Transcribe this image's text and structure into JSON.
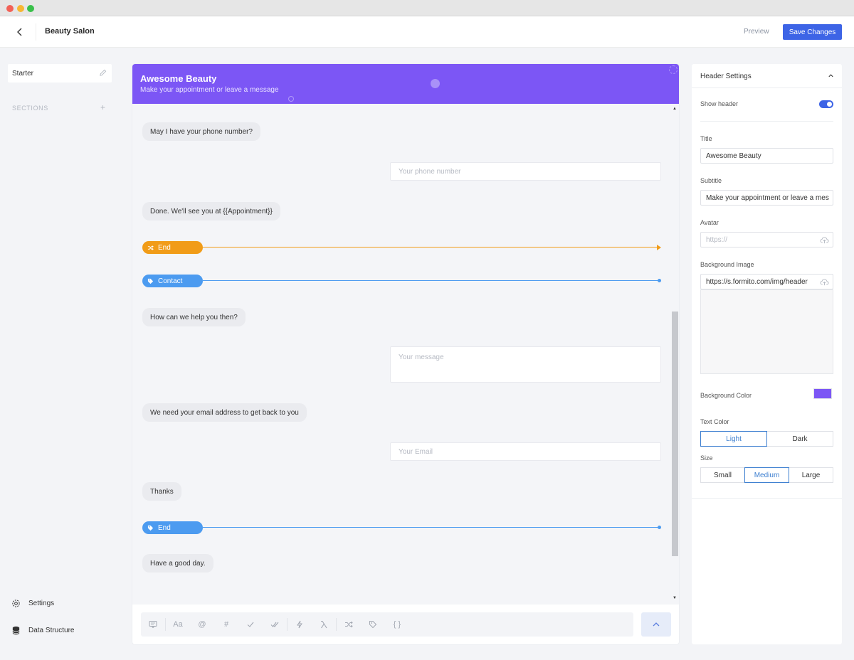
{
  "app": {
    "title": "Beauty Salon"
  },
  "topbar": {
    "preview_label": "Preview",
    "save_label": "Save Changes"
  },
  "sidebar": {
    "starter_label": "Starter",
    "sections_label": "SECTIONS",
    "sections_add": "+",
    "settings_label": "Settings",
    "data_structure_label": "Data Structure"
  },
  "chat": {
    "header_title": "Awesome Beauty",
    "header_subtitle": "Make your appointment or leave a message",
    "bot_messages": [
      "May I have your phone number?",
      "Done. We'll see you at {{Appointment}}",
      "How can we help you then?",
      "We need your email address to get back to you",
      "Thanks",
      "Have a good day."
    ],
    "inputs": [
      {
        "placeholder": "Your phone number"
      },
      {
        "placeholder": "Your message"
      },
      {
        "placeholder": "Your Email"
      }
    ],
    "logic": [
      {
        "label": "End",
        "color": "#f19c18",
        "icon": "shuffle-icon"
      },
      {
        "label": "Contact",
        "color": "#4c9bf0",
        "icon": "tag-icon"
      },
      {
        "label": "End",
        "color": "#4c9bf0",
        "icon": "tag-icon"
      }
    ],
    "toolbar": {
      "text_glyph": "Aa",
      "email_glyph": "@",
      "number_glyph": "#",
      "braces_glyph": "{ }"
    }
  },
  "settings": {
    "header_label": "Header Settings",
    "show_header_label": "Show header",
    "show_header": true,
    "title_label": "Title",
    "title_value": "Awesome Beauty",
    "subtitle_label": "Subtitle",
    "subtitle_value": "Make your appointment or leave a mes",
    "avatar_label": "Avatar",
    "avatar_placeholder": "https://",
    "bg_image_label": "Background Image",
    "bg_image_value": "https://s.formito.com/img/header",
    "bg_color_label": "Background Color",
    "bg_color": "#7c56f5",
    "text_color_label": "Text Color",
    "text_color_options": [
      "Light",
      "Dark"
    ],
    "text_color_selected": "Light",
    "size_label": "Size",
    "size_options": [
      "Small",
      "Medium",
      "Large"
    ],
    "size_selected": "Medium"
  }
}
